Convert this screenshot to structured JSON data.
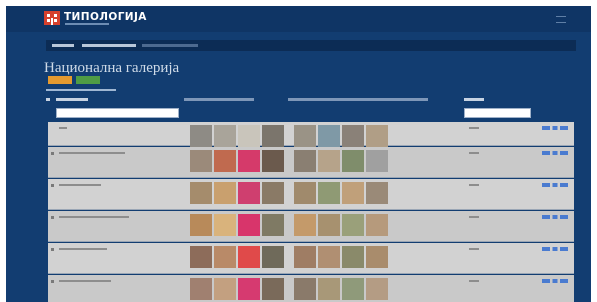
{
  "brand": {
    "name": "ТИПОЛОГИЈА"
  },
  "page": {
    "title": "Национална галерија"
  },
  "colors": {
    "header_bg": "#0f3565",
    "page_bg": "#123d71",
    "button_orange": "#e59a2f",
    "button_green": "#4f9c45",
    "row_bg": "#d2d2d2",
    "action_icons": "#4a7bd0"
  },
  "icons": {
    "logo": "building-logo-icon",
    "menu": "hamburger-menu-icon",
    "row_actions": "row-action-icons"
  },
  "rows": [
    {
      "thumbs_a": [
        "#8e8b85",
        "#a9a49a",
        "#c9c5bb",
        "#7b756c"
      ],
      "thumbs_b": [
        "#9a9386",
        "#7f99a6",
        "#8a8178",
        "#b09e86"
      ]
    },
    {
      "thumbs_a": [
        "#9b8a7a",
        "#c06a4f",
        "#d53a6a",
        "#6b5a4d"
      ],
      "thumbs_b": [
        "#8a7f72",
        "#b6a38a",
        "#7f8d6b",
        "#a0a0a0"
      ]
    },
    {
      "thumbs_a": [
        "#a58c6c",
        "#c9a06e",
        "#cf3f6f",
        "#8a7a66"
      ],
      "thumbs_b": [
        "#a08a6c",
        "#8f9a74",
        "#c0a07a",
        "#9a8a78"
      ]
    },
    {
      "thumbs_a": [
        "#b88a5a",
        "#d9b37c",
        "#d8356b",
        "#7f7a64"
      ],
      "thumbs_b": [
        "#c49a6a",
        "#a7916f",
        "#9aa07a",
        "#b69a7c"
      ]
    },
    {
      "thumbs_a": [
        "#8d6c5a",
        "#b98a68",
        "#e04a4a",
        "#6f6a5a"
      ],
      "thumbs_b": [
        "#9f7d64",
        "#b08f72",
        "#8a8a6a",
        "#a98c6c"
      ]
    },
    {
      "thumbs_a": [
        "#a08070",
        "#c3a080",
        "#d63a70",
        "#7a6a5a"
      ],
      "thumbs_b": [
        "#8a7a6a",
        "#a89878",
        "#8f9a7a",
        "#b49c84"
      ]
    }
  ]
}
